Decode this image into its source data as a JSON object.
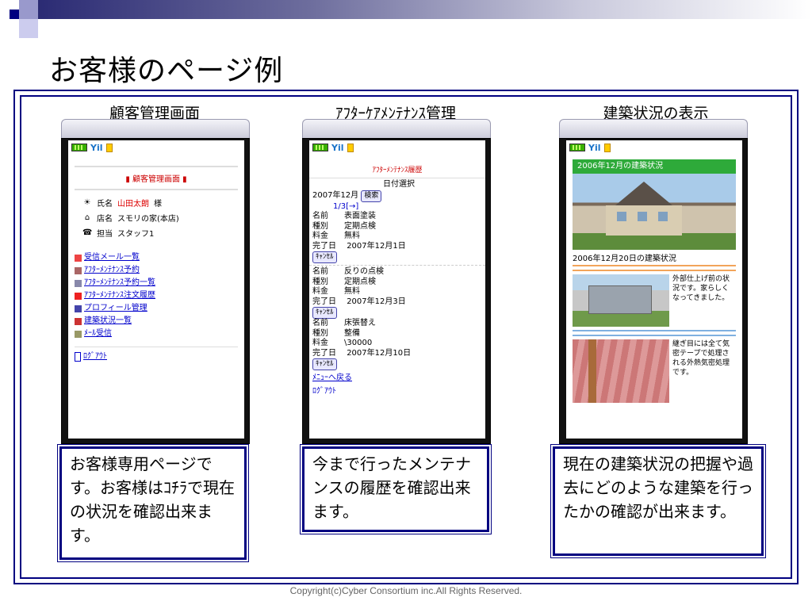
{
  "slide": {
    "title": "お客様のページ例",
    "copyright": "Copyright(c)Cyber Consortium inc.All Rights Reserved."
  },
  "columns": [
    {
      "title": "顧客管理画面"
    },
    {
      "title": "ｱﾌﾀｰｹｱﾒﾝﾃﾅﾝｽ管理"
    },
    {
      "title": "建築状況の表示"
    }
  ],
  "screen1": {
    "header": "顧客管理画面",
    "name_label": "氏名",
    "name_value": "山田太朗",
    "name_suffix": "様",
    "store_label": "店名",
    "store_value": "スモリの家(本店)",
    "staff_label": "担当",
    "staff_value": "スタッフ1",
    "menu": [
      "受信メール一覧",
      "ｱﾌﾀｰﾒﾝﾃﾅﾝｽ予約",
      "ｱﾌﾀｰﾒﾝﾃﾅﾝｽ予約一覧",
      "ｱﾌﾀｰﾒﾝﾃﾅﾝｽ注文履歴",
      "プロフィール管理",
      "建築状況一覧",
      "ﾒｰﾙ受信"
    ],
    "logout": "ﾛｸﾞｱｳﾄ"
  },
  "screen2": {
    "title": "ｱﾌﾀｰﾒﾝﾃﾅﾝｽ履歴",
    "date_select": "日付選択",
    "date_value": "2007年12月",
    "search": "検索",
    "pager": "1/3[→]",
    "labels": {
      "name": "名前",
      "type": "種別",
      "fee": "料金",
      "done": "完了日"
    },
    "cancel": "ｷｬﾝｾﾙ",
    "records": [
      {
        "name": "表面塗装",
        "type": "定期点検",
        "fee": "無料",
        "done": "2007年12月1日"
      },
      {
        "name": "反りの点検",
        "type": "定期点検",
        "fee": "無料",
        "done": "2007年12月3日"
      },
      {
        "name": "床張替え",
        "type": "整備",
        "fee": "\\30000",
        "done": "2007年12月10日"
      }
    ],
    "back": "ﾒﾆｭｰへ戻る",
    "logout": "ﾛｸﾞｱｳﾄ"
  },
  "screen3": {
    "header": "2006年12月の建築状況",
    "caption": "2006年12月20日の建築状況",
    "text1": "外部仕上げ前の状況です。家らしくなってきました。",
    "text2": "継ぎ目には全て気密テープで処理される外熱気密処理です。"
  },
  "notes": [
    "お客様専用ページです。お客様はｺﾁﾗで現在の状況を確認出来ます。",
    "今まで行ったメンテナンスの履歴を確認出来ます。",
    "現在の建築状況の把握や過去にどのような建築を行ったかの確認が出来ます。"
  ]
}
